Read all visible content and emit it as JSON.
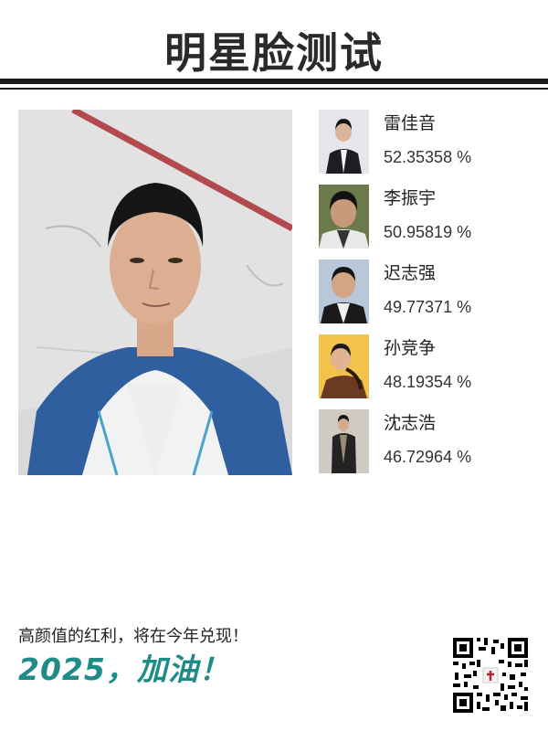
{
  "header": {
    "title": "明星脸测试"
  },
  "main_photo": {
    "icon": "person-portrait"
  },
  "matches": [
    {
      "name": "雷佳音",
      "score": "52.35358 %"
    },
    {
      "name": "李振宇",
      "score": "50.95819 %"
    },
    {
      "name": "迟志强",
      "score": "49.77371 %"
    },
    {
      "name": "孙竞争",
      "score": "48.19354 %"
    },
    {
      "name": "沈志浩",
      "score": "46.72964 %"
    }
  ],
  "footer": {
    "slogan": "高颜值的红利，将在今年兑现！",
    "cheer": "2025，加油！"
  },
  "colors": {
    "accent": "#1e8c86",
    "title": "#2a2a2a",
    "rule": "#1a1a1a"
  }
}
